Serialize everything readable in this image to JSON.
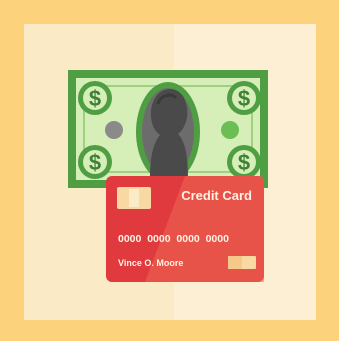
{
  "card": {
    "title": "Credit Card",
    "number": "0000  0000  0000  0000",
    "holder": "Vince O. Moore"
  },
  "banknote": {
    "corner_symbol": "$",
    "corner_symbols": [
      "$",
      "$",
      "$",
      "$"
    ]
  },
  "colors": {
    "frame": "#fcd27c",
    "panel_left": "#faeac6",
    "panel_right": "#fdefd4",
    "note_dark": "#4f9e44",
    "note_mid": "#6bbf52",
    "note_light": "#d6eeb8",
    "portrait": "#555555",
    "card_red": "#e0393e",
    "card_light": "#ef6a52",
    "chip": "#f9d9a3"
  },
  "icons": {
    "corner_emblem": "dollar-sign-icon",
    "portrait": "portrait-silhouette-icon",
    "chip": "card-chip-icon",
    "logo": "card-brand-logo-icon"
  }
}
